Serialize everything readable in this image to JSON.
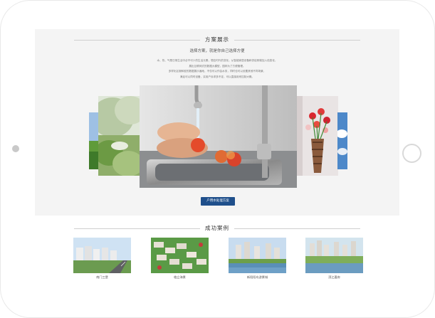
{
  "solution": {
    "title": "方案展示",
    "subtitle": "选择方案，就是你自己选择方便",
    "desc_lines": [
      "水、热、气是日常生活中必不可少的生活元素，想应时代的变化，从智能家居设备和供给侧端加入信息化，",
      "展出互联网式的数据大模型，园林为了方便管理。",
      "多样化区服和股的数据展示遍地，不仅可以作会水务，同时也可以设置其他不同场景，",
      "满足可以同时设备，实用户诉求多不定，可以直接用来控制大概。"
    ],
    "button_label": "户用水处理方案"
  },
  "cases": {
    "title": "成功案例",
    "items": [
      {
        "caption": "南门三堡"
      },
      {
        "caption": "临立海景"
      },
      {
        "caption": "新阳阳岛游景城"
      },
      {
        "caption": "滨江嘉府"
      }
    ]
  }
}
